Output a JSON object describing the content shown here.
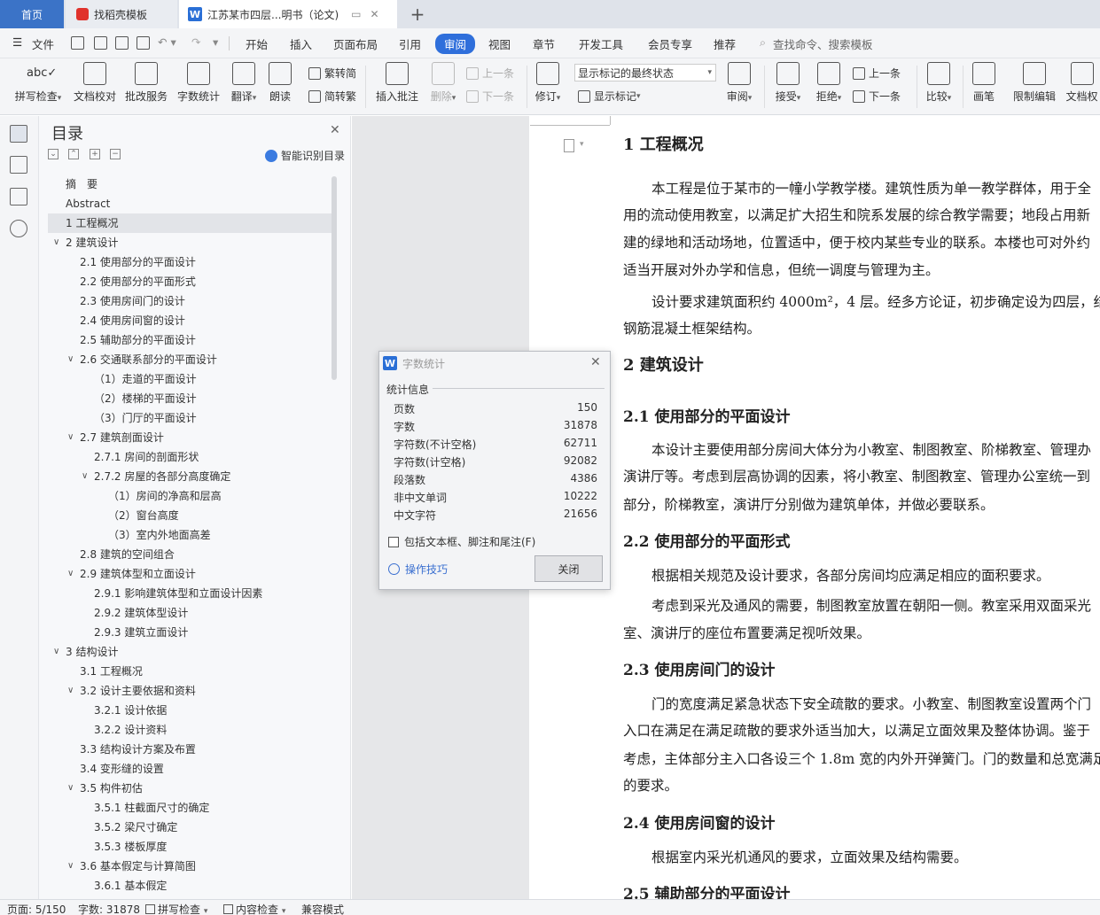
{
  "tabs": {
    "home": "首页",
    "templates": "找稻壳模板",
    "document": "江苏某市四层...明书（论文)",
    "new_tab": "+"
  },
  "menu": {
    "file": "文件",
    "items": [
      "开始",
      "插入",
      "页面布局",
      "引用",
      "审阅",
      "视图",
      "章节",
      "开发工具",
      "会员专享",
      "推荐"
    ],
    "active": "审阅",
    "search": "查找命令、搜索模板"
  },
  "ribbon": {
    "spellcheck": "拼写检查",
    "doc_proof": "文档校对",
    "batch_service": "批改服务",
    "word_count": "字数统计",
    "translate": "翻译",
    "read_aloud": "朗读",
    "to_traditional": "繁转简",
    "to_simplified": "简转繁",
    "insert_comment": "插入批注",
    "delete": "删除",
    "prev_comment": "上一条",
    "next_comment": "下一条",
    "revise": "修订",
    "markup_select": "显示标记的最终状态",
    "show_markup": "显示标记",
    "review": "审阅",
    "accept": "接受",
    "reject": "拒绝",
    "prev_change": "上一条",
    "next_change": "下一条",
    "compare": "比较",
    "ink": "画笔",
    "restrict_edit": "限制编辑",
    "doc_rights": "文档权"
  },
  "toc": {
    "title": "目录",
    "smart_label": "智能识别目录",
    "items": [
      {
        "text": "摘　要",
        "level": 0,
        "arrow": ""
      },
      {
        "text": "Abstract",
        "level": 0,
        "arrow": ""
      },
      {
        "text": "1  工程概况",
        "level": 0,
        "arrow": "",
        "selected": true
      },
      {
        "text": "2  建筑设计",
        "level": 0,
        "arrow": "v"
      },
      {
        "text": "2.1 使用部分的平面设计",
        "level": 1,
        "arrow": ""
      },
      {
        "text": "2.2 使用部分的平面形式",
        "level": 1,
        "arrow": ""
      },
      {
        "text": "2.3 使用房间门的设计",
        "level": 1,
        "arrow": ""
      },
      {
        "text": "2.4  使用房间窗的设计",
        "level": 1,
        "arrow": ""
      },
      {
        "text": "2.5  辅助部分的平面设计",
        "level": 1,
        "arrow": ""
      },
      {
        "text": "2.6  交通联系部分的平面设计",
        "level": 1,
        "arrow": "v"
      },
      {
        "text": "（1）走道的平面设计",
        "level": 2,
        "arrow": ""
      },
      {
        "text": "（2）楼梯的平面设计",
        "level": 2,
        "arrow": ""
      },
      {
        "text": "（3）门厅的平面设计",
        "level": 2,
        "arrow": ""
      },
      {
        "text": "2.7  建筑剖面设计",
        "level": 1,
        "arrow": "v"
      },
      {
        "text": "2.7.1 房间的剖面形状",
        "level": 2,
        "arrow": ""
      },
      {
        "text": "2.7.2 房屋的各部分高度确定",
        "level": 2,
        "arrow": "v"
      },
      {
        "text": "（1）房间的净高和层高",
        "level": 3,
        "arrow": ""
      },
      {
        "text": "（2）窗台高度",
        "level": 3,
        "arrow": ""
      },
      {
        "text": "（3）室内外地面高差",
        "level": 3,
        "arrow": ""
      },
      {
        "text": "2.8 建筑的空间组合",
        "level": 1,
        "arrow": ""
      },
      {
        "text": "2.9  建筑体型和立面设计",
        "level": 1,
        "arrow": "v"
      },
      {
        "text": "2.9.1  影响建筑体型和立面设计因素",
        "level": 2,
        "arrow": ""
      },
      {
        "text": "2.9.2  建筑体型设计",
        "level": 2,
        "arrow": ""
      },
      {
        "text": "2.9.3  建筑立面设计",
        "level": 2,
        "arrow": ""
      },
      {
        "text": "3  结构设计",
        "level": 0,
        "arrow": "v"
      },
      {
        "text": "3.1  工程概况",
        "level": 1,
        "arrow": ""
      },
      {
        "text": "3.2    设计主要依据和资料",
        "level": 1,
        "arrow": "v"
      },
      {
        "text": "3.2.1    设计依据",
        "level": 2,
        "arrow": ""
      },
      {
        "text": "3.2.2    设计资料",
        "level": 2,
        "arrow": ""
      },
      {
        "text": "3.3  结构设计方案及布置",
        "level": 1,
        "arrow": ""
      },
      {
        "text": "3.4 变形缝的设置",
        "level": 1,
        "arrow": ""
      },
      {
        "text": "3.5    构件初估",
        "level": 1,
        "arrow": "v"
      },
      {
        "text": "3.5.1    柱截面尺寸的确定",
        "level": 2,
        "arrow": ""
      },
      {
        "text": "3.5.2    梁尺寸确定",
        "level": 2,
        "arrow": ""
      },
      {
        "text": "3.5.3    楼板厚度",
        "level": 2,
        "arrow": ""
      },
      {
        "text": "3.6    基本假定与计算简图",
        "level": 1,
        "arrow": "v"
      },
      {
        "text": "3.6.1    基本假定",
        "level": 2,
        "arrow": ""
      }
    ]
  },
  "document": {
    "h1_1": "1  工程概况",
    "p1": "本工程是位于某市的一幢小学教学楼。建筑性质为单一教学群体，用于全",
    "p2": "用的流动使用教室，以满足扩大招生和院系发展的综合教学需要；地段占用新",
    "p3": "建的绿地和活动场地，位置适中，便于校内某些专业的联系。本楼也可对外约",
    "p4": "适当开展对外办学和信息，但统一调度与管理为主。",
    "p5": "设计要求建筑面积约 4000m²，4 层。经多方论证，初步确定设为四层，结",
    "p6": "钢筋混凝土框架结构。",
    "h1_2": "2  建筑设计",
    "h2_1": "2.1 使用部分的平面设计",
    "p7": "本设计主要使用部分房间大体分为小教室、制图教室、阶梯教室、管理办",
    "p8": "演讲厅等。考虑到层高协调的因素，将小教室、制图教室、管理办公室统一到",
    "p9": "部分，阶梯教室，演讲厅分别做为建筑单体，并做必要联系。",
    "h2_2": "2.2 使用部分的平面形式",
    "p10": "根据相关规范及设计要求，各部分房间均应满足相应的面积要求。",
    "p11": "考虑到采光及通风的需要，制图教室放置在朝阳一侧。教室采用双面采光",
    "p12": "室、演讲厅的座位布置要满足视听效果。",
    "h2_3": "2.3 使用房间门的设计",
    "p13": "门的宽度满足紧急状态下安全疏散的要求。小教室、制图教室设置两个门",
    "p14": "入口在满足在满足疏散的要求外适当加大，以满足立面效果及整体协调。鉴于",
    "p15": "考虑，主体部分主入口各设三个 1.8m 宽的内外开弹簧门。门的数量和总宽满足",
    "p16": "的要求。",
    "h2_4": "2.4  使用房间窗的设计",
    "p17": "根据室内采光机通风的要求，立面效果及结构需要。",
    "h2_5": "2.5  辅助部分的平面设计"
  },
  "dialog": {
    "title": "字数统计",
    "section": "统计信息",
    "rows": [
      {
        "label": "页数",
        "value": "150"
      },
      {
        "label": "字数",
        "value": "31878"
      },
      {
        "label": "字符数(不计空格)",
        "value": "62711"
      },
      {
        "label": "字符数(计空格)",
        "value": "92082"
      },
      {
        "label": "段落数",
        "value": "4386"
      },
      {
        "label": "非中文单词",
        "value": "10222"
      },
      {
        "label": "中文字符",
        "value": "21656"
      }
    ],
    "checkbox": "包括文本框、脚注和尾注(F)",
    "tips": "操作技巧",
    "close": "关闭"
  },
  "status": {
    "page": "页面: 5/150",
    "words": "字数: 31878",
    "spell": "拼写检查",
    "content": "内容检查",
    "compat": "兼容模式"
  },
  "colors": {
    "accent": "#2f6fdb",
    "home_tab": "#3b73c7",
    "toc_bg": "#f7f8fa",
    "workspace": "#e6e7e9"
  }
}
